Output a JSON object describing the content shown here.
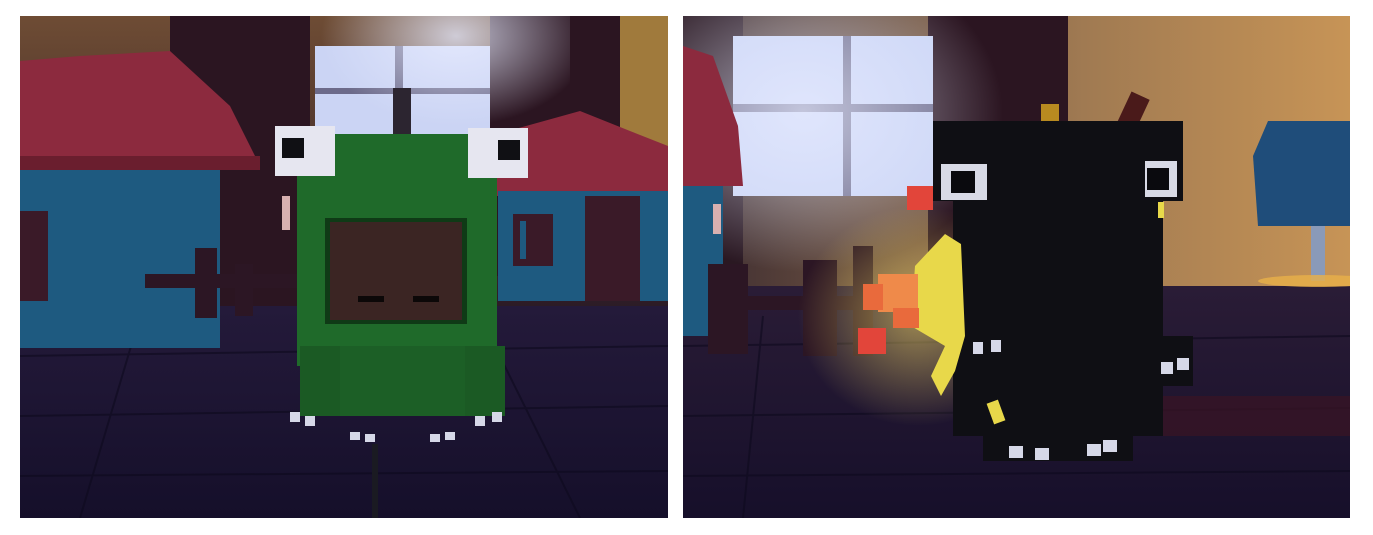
{
  "scene": {
    "panels": [
      {
        "id": "left",
        "subject": "frog-costume-character"
      },
      {
        "id": "right",
        "subject": "bird-costume-character"
      }
    ],
    "colors": {
      "floor": "#1a1434",
      "wall": "#7a5a3a",
      "curtain": "#2a1420",
      "window": "#cdd6f6",
      "roof": "#8f2a3c",
      "house": "#1f5f86",
      "frog_green": "#1f6a2a",
      "face": "#3a2424",
      "bird_black": "#0f0f14",
      "flame_yellow": "#e8d84a",
      "flame_red": "#e2453a",
      "lamp_blue": "#1f4d7a"
    },
    "icons": {
      "left_character": "frog-costume-icon",
      "right_character": "black-bird-costume-icon",
      "right_effect": "fire-breath-icon"
    }
  }
}
